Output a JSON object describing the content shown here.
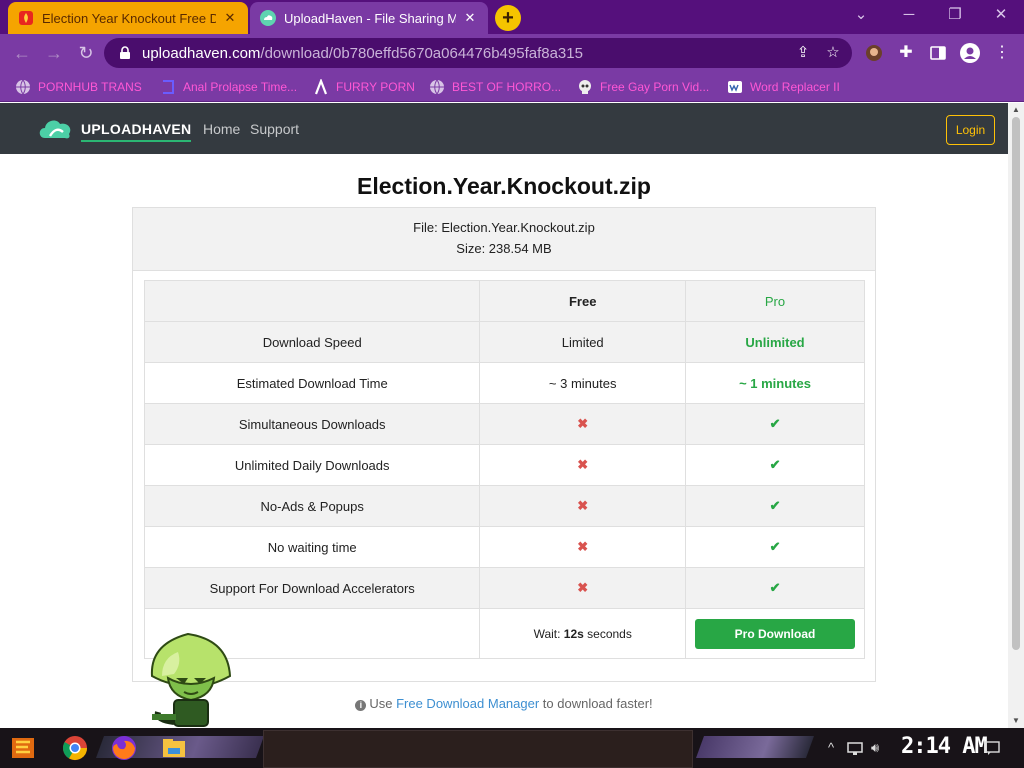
{
  "browser": {
    "tabs": [
      {
        "title": "Election Year Knockout Free D",
        "close": "✕"
      },
      {
        "title": "UploadHaven - File Sharing Ma",
        "close": "✕"
      }
    ],
    "new_tab": "+",
    "url_host": "uploadhaven.com",
    "url_path": "/download/0b780effd5670a064476b495faf8a315",
    "bookmarks": [
      "PORNHUB TRANS",
      "Anal Prolapse Time...",
      "FURRY PORN",
      "BEST OF HORRO...",
      "Free Gay Porn Vid...",
      "Word Replacer II"
    ],
    "colors": {
      "tabbar": "#55107c",
      "toolbar": "#7a3aa4",
      "bookmark_text": "#ff57d5",
      "active_tab": "#f5a400"
    }
  },
  "site": {
    "logo_text": "UPLOADHAVEN",
    "nav": [
      "Home",
      "Support"
    ],
    "login": "Login",
    "title": "Election.Year.Knockout.zip",
    "file_line": "File: Election.Year.Knockout.zip",
    "size_line": "Size: 238.54 MB",
    "table": {
      "col_free": "Free",
      "col_pro": "Pro",
      "rows": [
        {
          "feature": "Download Speed",
          "free": "Limited",
          "pro": "Unlimited"
        },
        {
          "feature": "Estimated Download Time",
          "free": "~ 3 minutes",
          "pro": "~ 1 minutes"
        },
        {
          "feature": "Simultaneous Downloads",
          "free": "✖",
          "pro": "✔"
        },
        {
          "feature": "Unlimited Daily Downloads",
          "free": "✖",
          "pro": "✔"
        },
        {
          "feature": "No-Ads & Popups",
          "free": "✖",
          "pro": "✔"
        },
        {
          "feature": "No waiting time",
          "free": "✖",
          "pro": "✔"
        },
        {
          "feature": "Support For Download Accelerators",
          "free": "✖",
          "pro": "✔"
        }
      ],
      "wait_prefix": "Wait: ",
      "wait_value": "12s",
      "wait_suffix": " seconds",
      "pro_button": "Pro Download"
    },
    "tip_prefix": "Use ",
    "tip_link": "Free Download Manager",
    "tip_suffix": " to download faster!",
    "colors": {
      "navbar": "#343a40",
      "pro_green": "#28a745",
      "x_red": "#d9534f",
      "login_yellow": "#ffc107",
      "link_blue": "#3d8fd1"
    }
  },
  "taskbar": {
    "clock": "2:14 AM"
  }
}
